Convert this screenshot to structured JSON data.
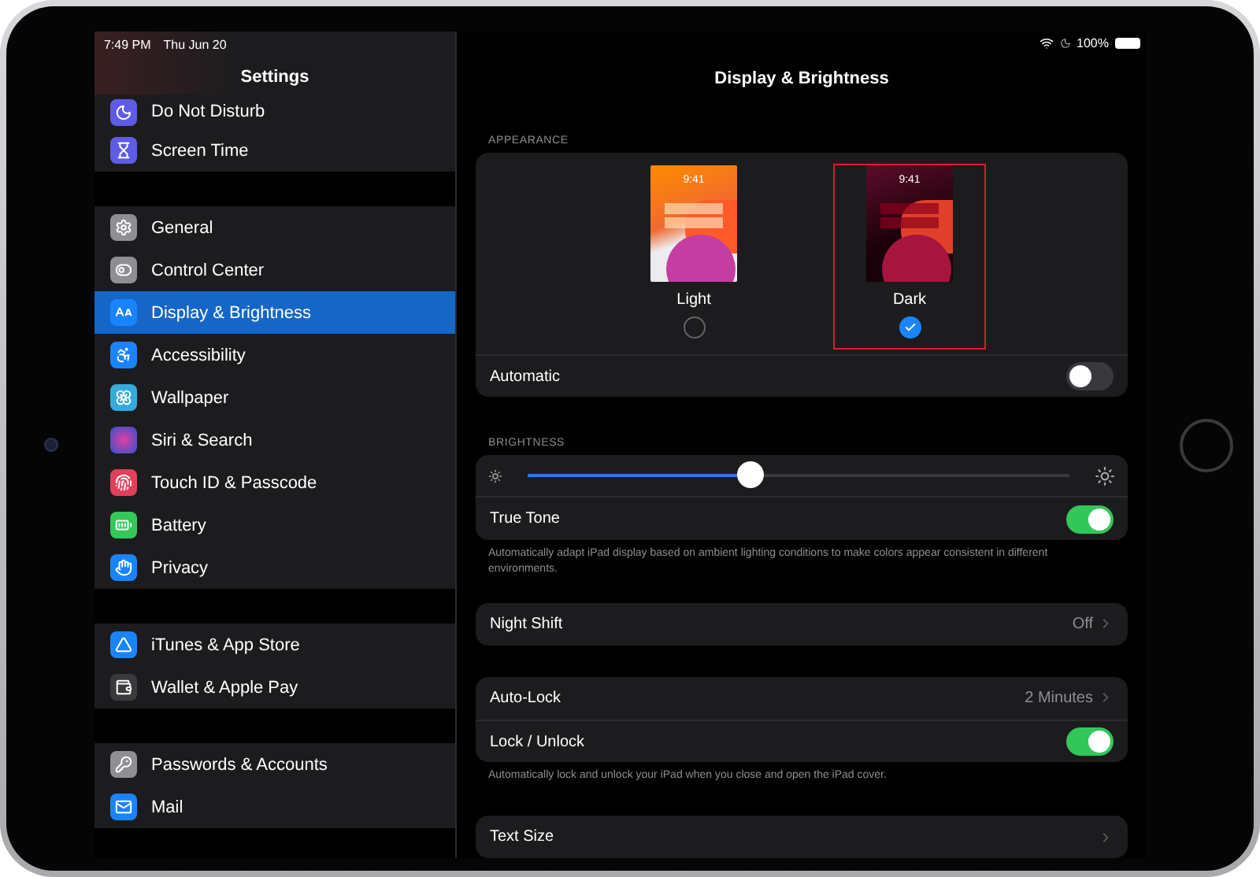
{
  "status_bar": {
    "time": "7:49 PM",
    "date": "Thu Jun 20",
    "battery": "100%"
  },
  "sidebar": {
    "title": "Settings",
    "groups": [
      {
        "items": [
          {
            "label": "Do Not Disturb",
            "selected": false
          },
          {
            "label": "Screen Time",
            "selected": false
          }
        ]
      },
      {
        "items": [
          {
            "label": "General",
            "selected": false
          },
          {
            "label": "Control Center",
            "selected": false
          },
          {
            "label": "Display & Brightness",
            "selected": true
          },
          {
            "label": "Accessibility",
            "selected": false
          },
          {
            "label": "Wallpaper",
            "selected": false
          },
          {
            "label": "Siri & Search",
            "selected": false
          },
          {
            "label": "Touch ID & Passcode",
            "selected": false
          },
          {
            "label": "Battery",
            "selected": false
          },
          {
            "label": "Privacy",
            "selected": false
          }
        ]
      },
      {
        "items": [
          {
            "label": "iTunes & App Store",
            "selected": false
          },
          {
            "label": "Wallet & Apple Pay",
            "selected": false
          }
        ]
      },
      {
        "items": [
          {
            "label": "Passwords & Accounts",
            "selected": false
          },
          {
            "label": "Mail",
            "selected": false
          }
        ]
      }
    ]
  },
  "detail": {
    "title": "Display & Brightness",
    "appearance": {
      "header": "APPEARANCE",
      "options": [
        {
          "kind": "light",
          "label": "Light",
          "preview_time": "9:41",
          "selected": false,
          "highlighted": false
        },
        {
          "kind": "dark",
          "label": "Dark",
          "preview_time": "9:41",
          "selected": true,
          "highlighted": true
        }
      ],
      "automatic": {
        "label": "Automatic",
        "on": false
      }
    },
    "brightness": {
      "header": "BRIGHTNESS",
      "level": 0.41,
      "true_tone": {
        "label": "True Tone",
        "on": true
      },
      "footnote": "Automatically adapt iPad display based on ambient lighting conditions to make colors appear consistent in different environments."
    },
    "groups": [
      {
        "rows": [
          {
            "kind": "link",
            "label": "Night Shift",
            "value": "Off"
          }
        ]
      },
      {
        "rows": [
          {
            "kind": "link",
            "label": "Auto-Lock",
            "value": "2 Minutes"
          },
          {
            "kind": "toggle",
            "label": "Lock / Unlock",
            "on": true
          }
        ],
        "footnote": "Automatically lock and unlock your iPad when you close and open the iPad cover."
      },
      {
        "rows": [
          {
            "kind": "link",
            "label": "Text Size"
          }
        ]
      }
    ]
  }
}
